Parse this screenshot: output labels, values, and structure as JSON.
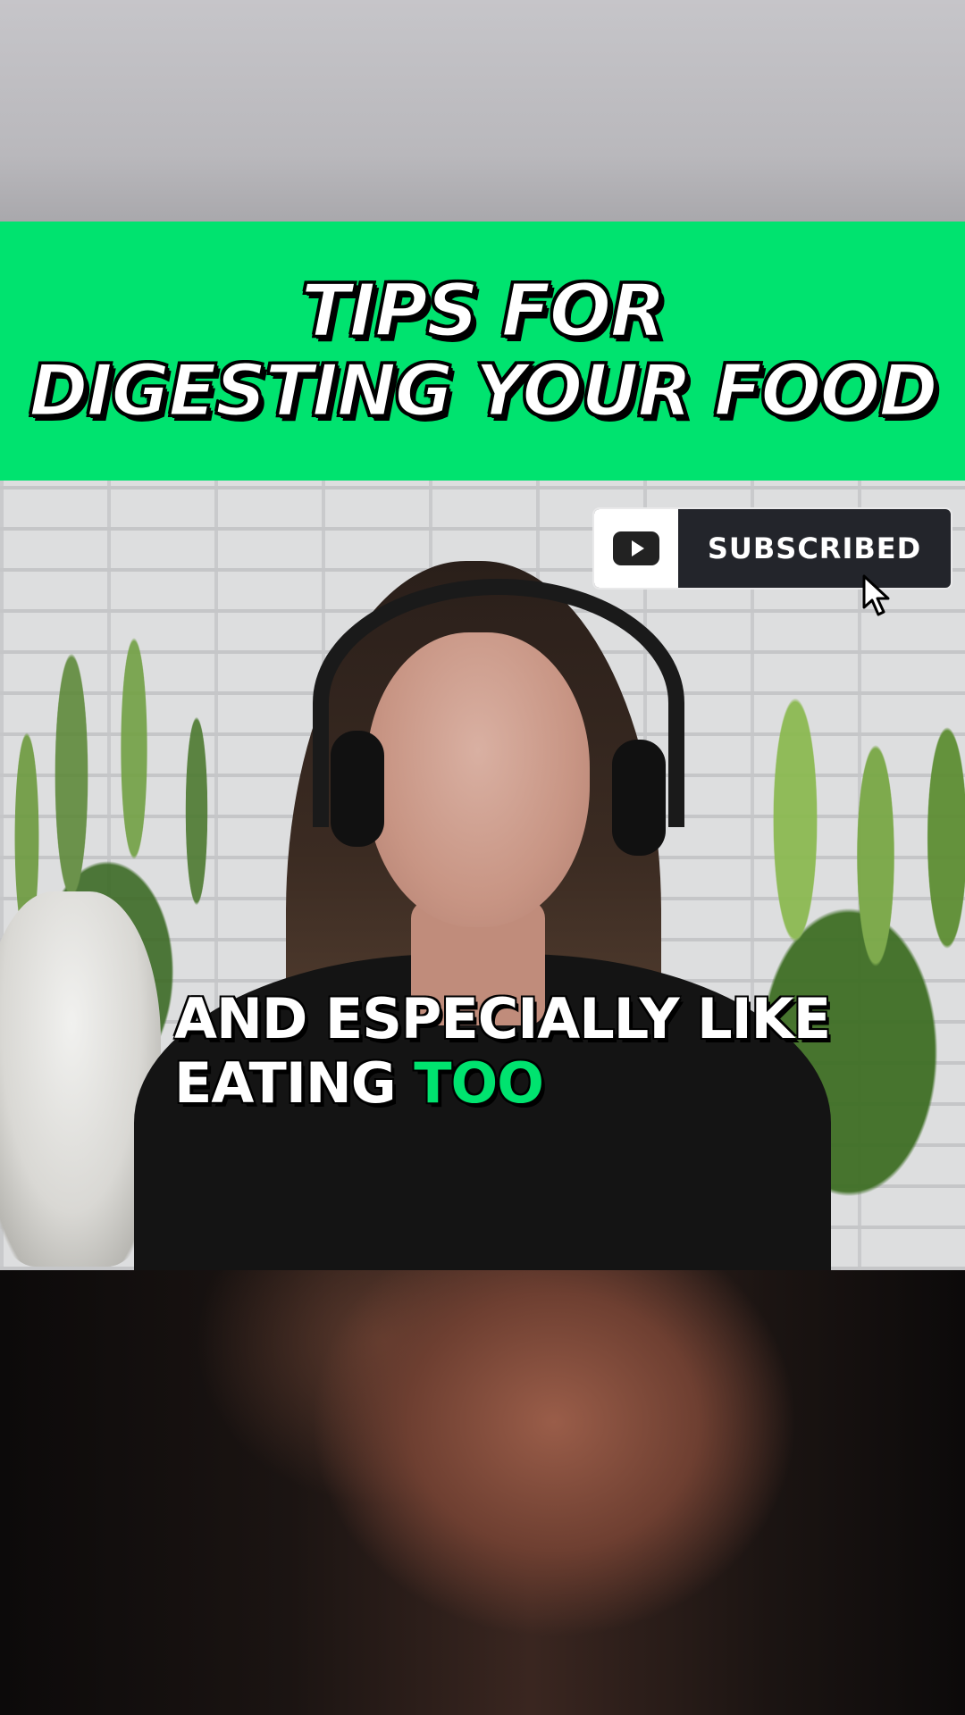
{
  "title": {
    "line1": "TIPS FOR",
    "line2": "DIGESTING YOUR FOOD"
  },
  "subscribe_button": {
    "label": "SUBSCRIBED",
    "icon": "youtube-play-icon"
  },
  "caption": {
    "line1": "AND ESPECIALLY LIKE",
    "line2_plain": "EATING ",
    "line2_highlight": "TOO"
  },
  "colors": {
    "banner_green": "#00e36f",
    "caption_highlight": "#00e36f",
    "subscribe_bg": "#23252b"
  }
}
